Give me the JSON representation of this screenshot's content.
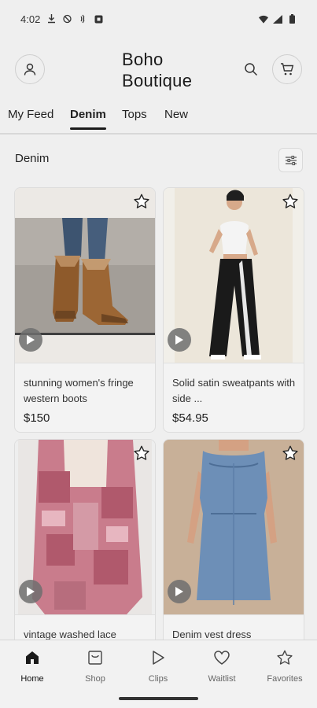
{
  "status_bar": {
    "time": "4:02"
  },
  "header": {
    "brand_line1": "Boho",
    "brand_line2": "Boutique"
  },
  "tabs": [
    {
      "label": "My Feed",
      "active": false
    },
    {
      "label": "Denim",
      "active": true
    },
    {
      "label": "Tops",
      "active": false
    },
    {
      "label": "New",
      "active": false
    }
  ],
  "section": {
    "title": "Denim"
  },
  "products": [
    {
      "title": "stunning women's fringe western boots",
      "price": "$150"
    },
    {
      "title": "Solid satin sweatpants with side ...",
      "price": "$54.95"
    },
    {
      "title": "vintage washed lace",
      "price": ""
    },
    {
      "title": "Denim vest dress",
      "price": ""
    }
  ],
  "bottom_nav": [
    {
      "label": "Home",
      "icon": "home-icon",
      "active": true
    },
    {
      "label": "Shop",
      "icon": "shop-icon",
      "active": false
    },
    {
      "label": "Clips",
      "icon": "play-icon",
      "active": false
    },
    {
      "label": "Waitlist",
      "icon": "heart-icon",
      "active": false
    },
    {
      "label": "Favorites",
      "icon": "star-icon",
      "active": false
    }
  ],
  "colors": {
    "background": "#efefef",
    "text": "#1c1c1c",
    "accent": "#1a1a1a"
  }
}
